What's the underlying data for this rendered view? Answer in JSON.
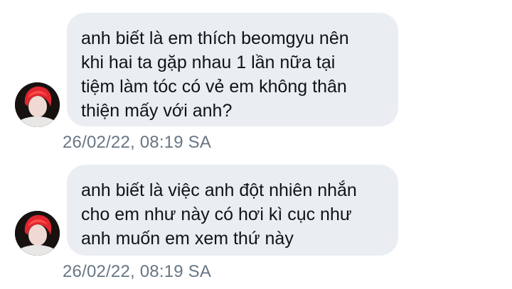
{
  "conversation": {
    "messages": [
      {
        "text": "anh biết là em thích beomgyu nên\nkhi hai ta gặp nhau 1 lần nữa tại\ntiệm làm tóc có vẻ em không thân\nthiện mấy với anh?",
        "timestamp": "26/02/22, 08:19 SA"
      },
      {
        "text": "anh biết là việc anh đột nhiên nhắn\ncho em như này có hơi kì cục như\nanh muốn em xem thứ này",
        "timestamp": "26/02/22, 08:19 SA"
      }
    ]
  },
  "colors": {
    "bubble_background": "#eaedf1",
    "message_text": "#0f1419",
    "timestamp_text": "#687684",
    "avatar_hair": "#e0262f"
  },
  "icons": {
    "sender_avatar": "profile-photo-avatar"
  }
}
